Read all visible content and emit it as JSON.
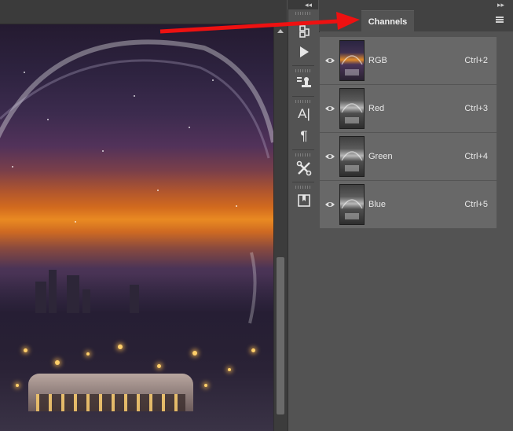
{
  "channels_panel": {
    "tab_label": "Channels",
    "channels": [
      {
        "name": "RGB",
        "shortcut": "Ctrl+2",
        "thumb": "rgb"
      },
      {
        "name": "Red",
        "shortcut": "Ctrl+3",
        "thumb": "gray"
      },
      {
        "name": "Green",
        "shortcut": "Ctrl+4",
        "thumb": "gray"
      },
      {
        "name": "Blue",
        "shortcut": "Ctrl+5",
        "thumb": "gray"
      }
    ]
  },
  "tool_strip": {
    "icons": [
      "history-icon",
      "actions-play-icon",
      "clone-source-icon",
      "character-icon",
      "paragraph-icon",
      "tool-presets-icon",
      "properties-icon"
    ]
  },
  "annotation": {
    "color": "#ee1111"
  },
  "colors": {
    "panel_bg": "#535353",
    "row_bg": "#686868",
    "header_bg": "#424242"
  }
}
